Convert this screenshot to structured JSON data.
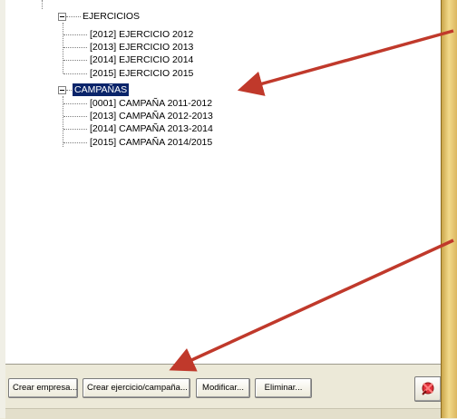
{
  "tree": {
    "ejercicios_label": "EJERCICIOS",
    "ejercicios_items": [
      "[2012] EJERCICIO 2012",
      "[2013] EJERCICIO 2013",
      "[2014] EJERCICIO 2014",
      "[2015] EJERCICIO 2015"
    ],
    "campanas_label": "CAMPAÑAS",
    "campanas_items": [
      "[0001] CAMPAÑA 2011-2012",
      "[2013] CAMPAÑA 2012-2013",
      "[2014] CAMPAÑA 2013-2014",
      "[2015] CAMPAÑA 2014/2015"
    ]
  },
  "buttons": {
    "crear_empresa": "Crear empresa...",
    "crear_ejercicio": "Crear ejercicio/campaña...",
    "modificar": "Modificar...",
    "eliminar": "Eliminar..."
  },
  "close_icon": "red-pin-close-icon",
  "annotation_color": "#c0392b",
  "selection_color": "#0a246a"
}
